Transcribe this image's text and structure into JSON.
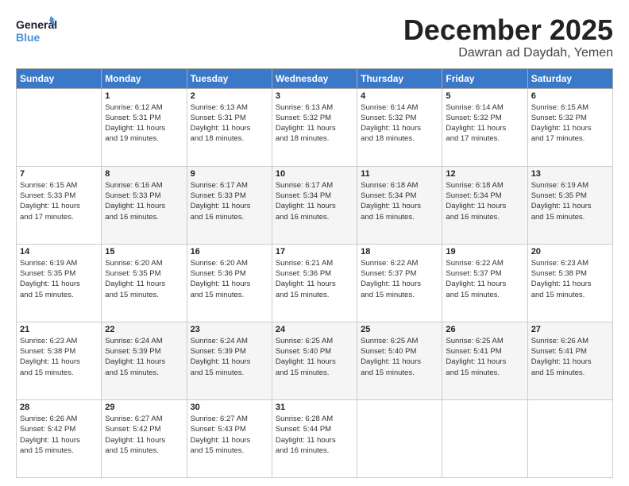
{
  "header": {
    "logo_general": "General",
    "logo_blue": "Blue",
    "month_title": "December 2025",
    "subtitle": "Dawran ad Daydah, Yemen"
  },
  "weekdays": [
    "Sunday",
    "Monday",
    "Tuesday",
    "Wednesday",
    "Thursday",
    "Friday",
    "Saturday"
  ],
  "weeks": [
    [
      {
        "day": "",
        "info": ""
      },
      {
        "day": "1",
        "info": "Sunrise: 6:12 AM\nSunset: 5:31 PM\nDaylight: 11 hours\nand 19 minutes."
      },
      {
        "day": "2",
        "info": "Sunrise: 6:13 AM\nSunset: 5:31 PM\nDaylight: 11 hours\nand 18 minutes."
      },
      {
        "day": "3",
        "info": "Sunrise: 6:13 AM\nSunset: 5:32 PM\nDaylight: 11 hours\nand 18 minutes."
      },
      {
        "day": "4",
        "info": "Sunrise: 6:14 AM\nSunset: 5:32 PM\nDaylight: 11 hours\nand 18 minutes."
      },
      {
        "day": "5",
        "info": "Sunrise: 6:14 AM\nSunset: 5:32 PM\nDaylight: 11 hours\nand 17 minutes."
      },
      {
        "day": "6",
        "info": "Sunrise: 6:15 AM\nSunset: 5:32 PM\nDaylight: 11 hours\nand 17 minutes."
      }
    ],
    [
      {
        "day": "7",
        "info": "Sunrise: 6:15 AM\nSunset: 5:33 PM\nDaylight: 11 hours\nand 17 minutes."
      },
      {
        "day": "8",
        "info": "Sunrise: 6:16 AM\nSunset: 5:33 PM\nDaylight: 11 hours\nand 16 minutes."
      },
      {
        "day": "9",
        "info": "Sunrise: 6:17 AM\nSunset: 5:33 PM\nDaylight: 11 hours\nand 16 minutes."
      },
      {
        "day": "10",
        "info": "Sunrise: 6:17 AM\nSunset: 5:34 PM\nDaylight: 11 hours\nand 16 minutes."
      },
      {
        "day": "11",
        "info": "Sunrise: 6:18 AM\nSunset: 5:34 PM\nDaylight: 11 hours\nand 16 minutes."
      },
      {
        "day": "12",
        "info": "Sunrise: 6:18 AM\nSunset: 5:34 PM\nDaylight: 11 hours\nand 16 minutes."
      },
      {
        "day": "13",
        "info": "Sunrise: 6:19 AM\nSunset: 5:35 PM\nDaylight: 11 hours\nand 15 minutes."
      }
    ],
    [
      {
        "day": "14",
        "info": "Sunrise: 6:19 AM\nSunset: 5:35 PM\nDaylight: 11 hours\nand 15 minutes."
      },
      {
        "day": "15",
        "info": "Sunrise: 6:20 AM\nSunset: 5:35 PM\nDaylight: 11 hours\nand 15 minutes."
      },
      {
        "day": "16",
        "info": "Sunrise: 6:20 AM\nSunset: 5:36 PM\nDaylight: 11 hours\nand 15 minutes."
      },
      {
        "day": "17",
        "info": "Sunrise: 6:21 AM\nSunset: 5:36 PM\nDaylight: 11 hours\nand 15 minutes."
      },
      {
        "day": "18",
        "info": "Sunrise: 6:22 AM\nSunset: 5:37 PM\nDaylight: 11 hours\nand 15 minutes."
      },
      {
        "day": "19",
        "info": "Sunrise: 6:22 AM\nSunset: 5:37 PM\nDaylight: 11 hours\nand 15 minutes."
      },
      {
        "day": "20",
        "info": "Sunrise: 6:23 AM\nSunset: 5:38 PM\nDaylight: 11 hours\nand 15 minutes."
      }
    ],
    [
      {
        "day": "21",
        "info": "Sunrise: 6:23 AM\nSunset: 5:38 PM\nDaylight: 11 hours\nand 15 minutes."
      },
      {
        "day": "22",
        "info": "Sunrise: 6:24 AM\nSunset: 5:39 PM\nDaylight: 11 hours\nand 15 minutes."
      },
      {
        "day": "23",
        "info": "Sunrise: 6:24 AM\nSunset: 5:39 PM\nDaylight: 11 hours\nand 15 minutes."
      },
      {
        "day": "24",
        "info": "Sunrise: 6:25 AM\nSunset: 5:40 PM\nDaylight: 11 hours\nand 15 minutes."
      },
      {
        "day": "25",
        "info": "Sunrise: 6:25 AM\nSunset: 5:40 PM\nDaylight: 11 hours\nand 15 minutes."
      },
      {
        "day": "26",
        "info": "Sunrise: 6:25 AM\nSunset: 5:41 PM\nDaylight: 11 hours\nand 15 minutes."
      },
      {
        "day": "27",
        "info": "Sunrise: 6:26 AM\nSunset: 5:41 PM\nDaylight: 11 hours\nand 15 minutes."
      }
    ],
    [
      {
        "day": "28",
        "info": "Sunrise: 6:26 AM\nSunset: 5:42 PM\nDaylight: 11 hours\nand 15 minutes."
      },
      {
        "day": "29",
        "info": "Sunrise: 6:27 AM\nSunset: 5:42 PM\nDaylight: 11 hours\nand 15 minutes."
      },
      {
        "day": "30",
        "info": "Sunrise: 6:27 AM\nSunset: 5:43 PM\nDaylight: 11 hours\nand 15 minutes."
      },
      {
        "day": "31",
        "info": "Sunrise: 6:28 AM\nSunset: 5:44 PM\nDaylight: 11 hours\nand 16 minutes."
      },
      {
        "day": "",
        "info": ""
      },
      {
        "day": "",
        "info": ""
      },
      {
        "day": "",
        "info": ""
      }
    ]
  ]
}
